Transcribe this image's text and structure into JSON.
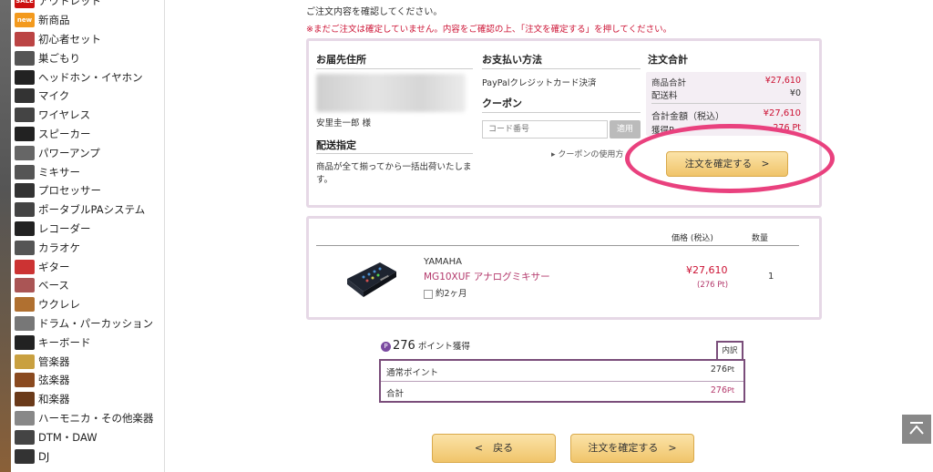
{
  "sidebar": {
    "items": [
      {
        "label": "アウトレット",
        "icon": "sale-badge-icon",
        "color": "#cc1111",
        "badge": "SALE"
      },
      {
        "label": "新商品",
        "icon": "new-badge-icon",
        "color": "#f39a1e",
        "badge": "new"
      },
      {
        "label": "初心者セット",
        "icon": "beginner-set-icon",
        "color": "#b44"
      },
      {
        "label": "巣ごもり",
        "icon": "stay-home-icon",
        "color": "#555"
      },
      {
        "label": "ヘッドホン・イヤホン",
        "icon": "headphones-icon",
        "color": "#222"
      },
      {
        "label": "マイク",
        "icon": "microphone-icon",
        "color": "#333"
      },
      {
        "label": "ワイヤレス",
        "icon": "wireless-icon",
        "color": "#444"
      },
      {
        "label": "スピーカー",
        "icon": "speaker-icon",
        "color": "#222"
      },
      {
        "label": "パワーアンプ",
        "icon": "power-amp-icon",
        "color": "#666"
      },
      {
        "label": "ミキサー",
        "icon": "mixer-icon",
        "color": "#555"
      },
      {
        "label": "プロセッサー",
        "icon": "processor-icon",
        "color": "#333"
      },
      {
        "label": "ポータブルPAシステム",
        "icon": "portable-pa-icon",
        "color": "#444"
      },
      {
        "label": "レコーダー",
        "icon": "recorder-icon",
        "color": "#222"
      },
      {
        "label": "カラオケ",
        "icon": "karaoke-icon",
        "color": "#555"
      },
      {
        "label": "ギター",
        "icon": "guitar-icon",
        "color": "#c33"
      },
      {
        "label": "ベース",
        "icon": "bass-icon",
        "color": "#a55"
      },
      {
        "label": "ウクレレ",
        "icon": "ukulele-icon",
        "color": "#b07030"
      },
      {
        "label": "ドラム・パーカッション",
        "icon": "drum-icon",
        "color": "#777"
      },
      {
        "label": "キーボード",
        "icon": "keyboard-icon",
        "color": "#222"
      },
      {
        "label": "管楽器",
        "icon": "wind-instrument-icon",
        "color": "#c9a040"
      },
      {
        "label": "弦楽器",
        "icon": "string-instrument-icon",
        "color": "#8a4a20"
      },
      {
        "label": "和楽器",
        "icon": "japanese-instrument-icon",
        "color": "#6a3a1a"
      },
      {
        "label": "ハーモニカ・その他楽器",
        "icon": "harmonica-icon",
        "color": "#888"
      },
      {
        "label": "DTM・DAW",
        "icon": "dtm-icon",
        "color": "#444"
      },
      {
        "label": "DJ",
        "icon": "dj-icon",
        "color": "#333"
      }
    ]
  },
  "header": {
    "intro": "ご注文内容を確認してください。",
    "warning": "※まだご注文は確定していません。内容をご確認の上、「注文を確定する」を押してください。"
  },
  "shipping": {
    "title": "お届先住所",
    "name": "安里圭一郎 様",
    "delivery_title": "配送指定",
    "delivery_text_1": "商品が全て揃ってから一括出荷いたしま",
    "delivery_text_2": "す。"
  },
  "payment": {
    "title": "お支払い方法",
    "method": "PayPalクレジットカード決済",
    "coupon_title": "クーポン",
    "coupon_placeholder": "コード番号",
    "apply_label": "適用",
    "coupon_link": "▸ クーポンの使用方"
  },
  "summary": {
    "title": "注文合計",
    "subtotal_label": "商品合計",
    "subtotal": "¥27,610",
    "shipping_label": "配送料",
    "shipping": "¥0",
    "total_label": "合計金額（税込）",
    "total": "¥27,610",
    "points_label": "獲得P",
    "points": "276 Pt",
    "confirm_label": "注文を確定する　>"
  },
  "item_table": {
    "price_header": "価格 (税込)",
    "qty_header": "数量",
    "brand": "YAMAHA",
    "name": "MG10XUF アナログミキサー",
    "lead_time": "約2ヶ月",
    "price": "¥27,610",
    "points": "(276 Pt)",
    "qty": "1"
  },
  "points": {
    "amount": "276",
    "earned_label": "ポイント獲得",
    "breakdown_tab": "内訳",
    "normal_label": "通常ポイント",
    "normal_value": "276",
    "total_label": "合計",
    "total_value": "276",
    "unit": "Pt"
  },
  "footer": {
    "back_label": "<　戻る",
    "confirm_label": "注文を確定する　>"
  },
  "colors": {
    "accent_red": "#cc1133",
    "highlight": "#e9417e",
    "panel_border": "#e6d8e6",
    "button": "#f0c46a"
  }
}
